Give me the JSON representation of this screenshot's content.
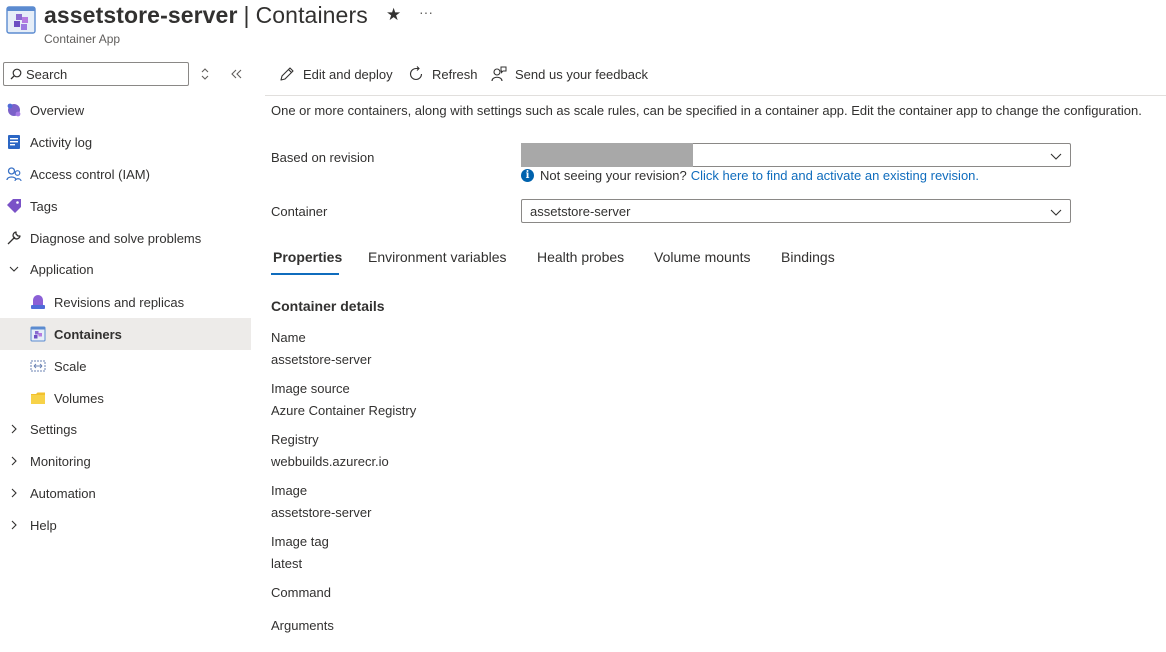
{
  "header": {
    "resource_name": "assetstore-server",
    "separator": "|",
    "blade_name": "Containers",
    "subtitle": "Container App",
    "star_icon": "★",
    "more_icon": "···"
  },
  "sidebar": {
    "search_placeholder": "Search",
    "items": [
      {
        "label": "Overview",
        "icon": "overview-icon"
      },
      {
        "label": "Activity log",
        "icon": "activity-log-icon"
      },
      {
        "label": "Access control (IAM)",
        "icon": "iam-icon"
      },
      {
        "label": "Tags",
        "icon": "tag-icon"
      },
      {
        "label": "Diagnose and solve problems",
        "icon": "wrench-icon"
      },
      {
        "label": "Application",
        "icon": "chevron-down-icon"
      },
      {
        "label": "Revisions and replicas",
        "icon": "revisions-icon"
      },
      {
        "label": "Containers",
        "icon": "containers-icon",
        "selected": true
      },
      {
        "label": "Scale",
        "icon": "scale-icon"
      },
      {
        "label": "Volumes",
        "icon": "folder-icon"
      },
      {
        "label": "Settings",
        "icon": "chevron-right-icon"
      },
      {
        "label": "Monitoring",
        "icon": "chevron-right-icon"
      },
      {
        "label": "Automation",
        "icon": "chevron-right-icon"
      },
      {
        "label": "Help",
        "icon": "chevron-right-icon"
      }
    ]
  },
  "toolbar": {
    "edit_deploy": "Edit and deploy",
    "refresh": "Refresh",
    "feedback": "Send us your feedback"
  },
  "main": {
    "description": "One or more containers, along with settings such as scale rules, can be specified in a container app. Edit the container app to change the configuration.",
    "revision_label": "Based on revision",
    "revision_value": "",
    "revision_hint": "Not seeing your revision?",
    "revision_link": "Click here to find and activate an existing revision.",
    "container_label": "Container",
    "container_value": "assetstore-server",
    "tabs": [
      {
        "label": "Properties",
        "active": true
      },
      {
        "label": "Environment variables"
      },
      {
        "label": "Health probes"
      },
      {
        "label": "Volume mounts"
      },
      {
        "label": "Bindings"
      }
    ],
    "section_heading": "Container details",
    "details": [
      {
        "label": "Name",
        "value": "assetstore-server"
      },
      {
        "label": "Image source",
        "value": "Azure Container Registry"
      },
      {
        "label": "Registry",
        "value": "webbuilds.azurecr.io"
      },
      {
        "label": "Image",
        "value": "assetstore-server"
      },
      {
        "label": "Image tag",
        "value": "latest"
      },
      {
        "label": "Command",
        "value": ""
      },
      {
        "label": "Arguments",
        "value": ""
      }
    ]
  },
  "colors": {
    "accent": "#0f6cbd",
    "selected_bg": "#edebe9",
    "info_blue": "#0062ad"
  }
}
